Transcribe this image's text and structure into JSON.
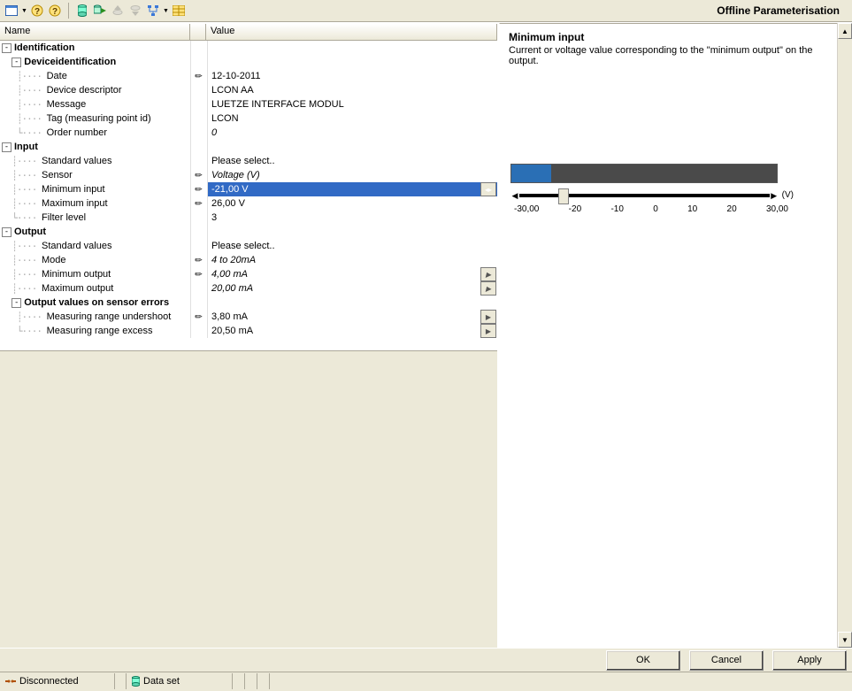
{
  "header": {
    "title": "Offline Parameterisation"
  },
  "columns": {
    "name": "Name",
    "value": "Value"
  },
  "tree": {
    "identification": {
      "label": "Identification",
      "device_identification": {
        "label": "Deviceidentification",
        "date": {
          "label": "Date",
          "value": "12-10-2011"
        },
        "device_descriptor": {
          "label": "Device descriptor",
          "value": "LCON AA"
        },
        "message": {
          "label": "Message",
          "value": "LUETZE INTERFACE MODUL"
        },
        "tag": {
          "label": "Tag (measuring point id)",
          "value": "LCON"
        },
        "order_number": {
          "label": "Order number",
          "value": "0"
        }
      }
    },
    "input": {
      "label": "Input",
      "standard_values": {
        "label": "Standard values",
        "value": "Please select.."
      },
      "sensor": {
        "label": "Sensor",
        "value": "Voltage (V)"
      },
      "minimum_input": {
        "label": "Minimum input",
        "value": "-21,00 V"
      },
      "maximum_input": {
        "label": "Maximum input",
        "value": "26,00 V"
      },
      "filter_level": {
        "label": "Filter level",
        "value": "3"
      }
    },
    "output": {
      "label": "Output",
      "standard_values": {
        "label": "Standard values",
        "value": "Please select.."
      },
      "mode": {
        "label": "Mode",
        "value": "4 to 20mA"
      },
      "minimum_output": {
        "label": "Minimum output",
        "value": "4,00 mA"
      },
      "maximum_output": {
        "label": "Maximum output",
        "value": "20,00 mA"
      },
      "errors": {
        "label": "Output values on sensor errors",
        "undershoot": {
          "label": "Measuring range undershoot",
          "value": "3,80 mA"
        },
        "excess": {
          "label": "Measuring range excess",
          "value": "20,50 mA"
        }
      }
    }
  },
  "detail": {
    "title": "Minimum input",
    "desc": "Current or voltage value corresponding to the \"minimum output\" on the output.",
    "unit": "(V)",
    "ticks": [
      "-30,00",
      "-20",
      "-10",
      "0",
      "10",
      "20",
      "30,00"
    ]
  },
  "buttons": {
    "ok": "OK",
    "cancel": "Cancel",
    "apply": "Apply"
  },
  "status": {
    "disconnected": "Disconnected",
    "dataset": "Data set"
  }
}
